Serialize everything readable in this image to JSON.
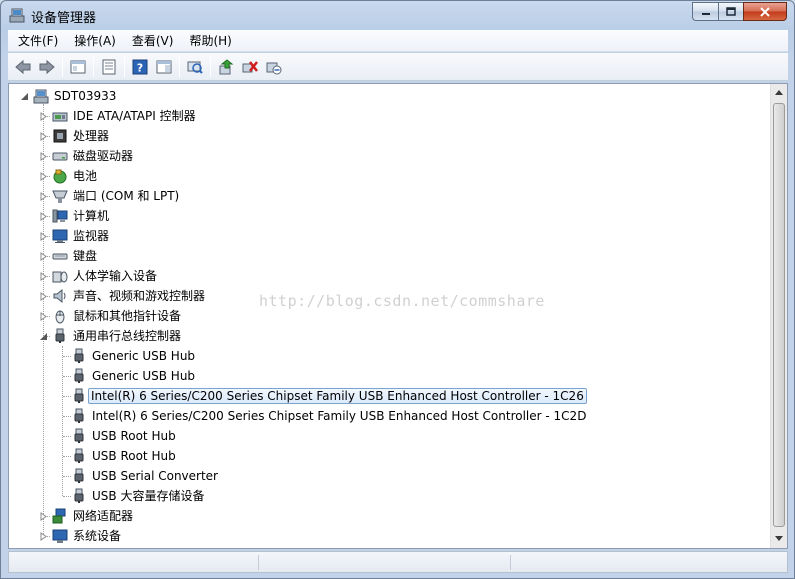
{
  "window": {
    "title": "设备管理器",
    "minimize_label": "—",
    "maximize_label": "□",
    "close_label": "✕"
  },
  "menu": {
    "items": [
      {
        "label": "文件(F)"
      },
      {
        "label": "操作(A)"
      },
      {
        "label": "查看(V)"
      },
      {
        "label": "帮助(H)"
      }
    ]
  },
  "toolbar": {
    "buttons": [
      "back-icon",
      "forward-icon",
      "show-hide-tree-icon",
      "properties-icon",
      "help-icon",
      "action-pane-icon",
      "scan-hardware-icon",
      "update-driver-icon",
      "uninstall-icon",
      "disable-icon"
    ]
  },
  "tree": {
    "root": {
      "label": "SDT03933"
    },
    "categories": [
      {
        "label": "IDE ATA/ATAPI 控制器",
        "expanded": false
      },
      {
        "label": "处理器",
        "expanded": false
      },
      {
        "label": "磁盘驱动器",
        "expanded": false
      },
      {
        "label": "电池",
        "expanded": false
      },
      {
        "label": "端口 (COM 和 LPT)",
        "expanded": false
      },
      {
        "label": "计算机",
        "expanded": false
      },
      {
        "label": "监视器",
        "expanded": false
      },
      {
        "label": "键盘",
        "expanded": false
      },
      {
        "label": "人体学输入设备",
        "expanded": false
      },
      {
        "label": "声音、视频和游戏控制器",
        "expanded": false
      },
      {
        "label": "鼠标和其他指针设备",
        "expanded": false
      },
      {
        "label": "通用串行总线控制器",
        "expanded": true
      },
      {
        "label": "网络适配器",
        "expanded": false
      },
      {
        "label": "系统设备",
        "expanded": false
      }
    ],
    "usb_children": [
      {
        "label": "Generic USB Hub"
      },
      {
        "label": "Generic USB Hub"
      },
      {
        "label": "Intel(R) 6 Series/C200 Series Chipset Family USB Enhanced Host Controller - 1C26",
        "selected": true
      },
      {
        "label": "Intel(R) 6 Series/C200 Series Chipset Family USB Enhanced Host Controller - 1C2D"
      },
      {
        "label": "USB Root Hub"
      },
      {
        "label": "USB Root Hub"
      },
      {
        "label": "USB Serial Converter"
      },
      {
        "label": "USB 大容量存储设备"
      }
    ]
  },
  "watermark": "http://blog.csdn.net/commshare",
  "colors": {
    "selection_border": "#7da2ce",
    "selection_fill": "#dbeafb",
    "close_button": "#c3391d"
  }
}
